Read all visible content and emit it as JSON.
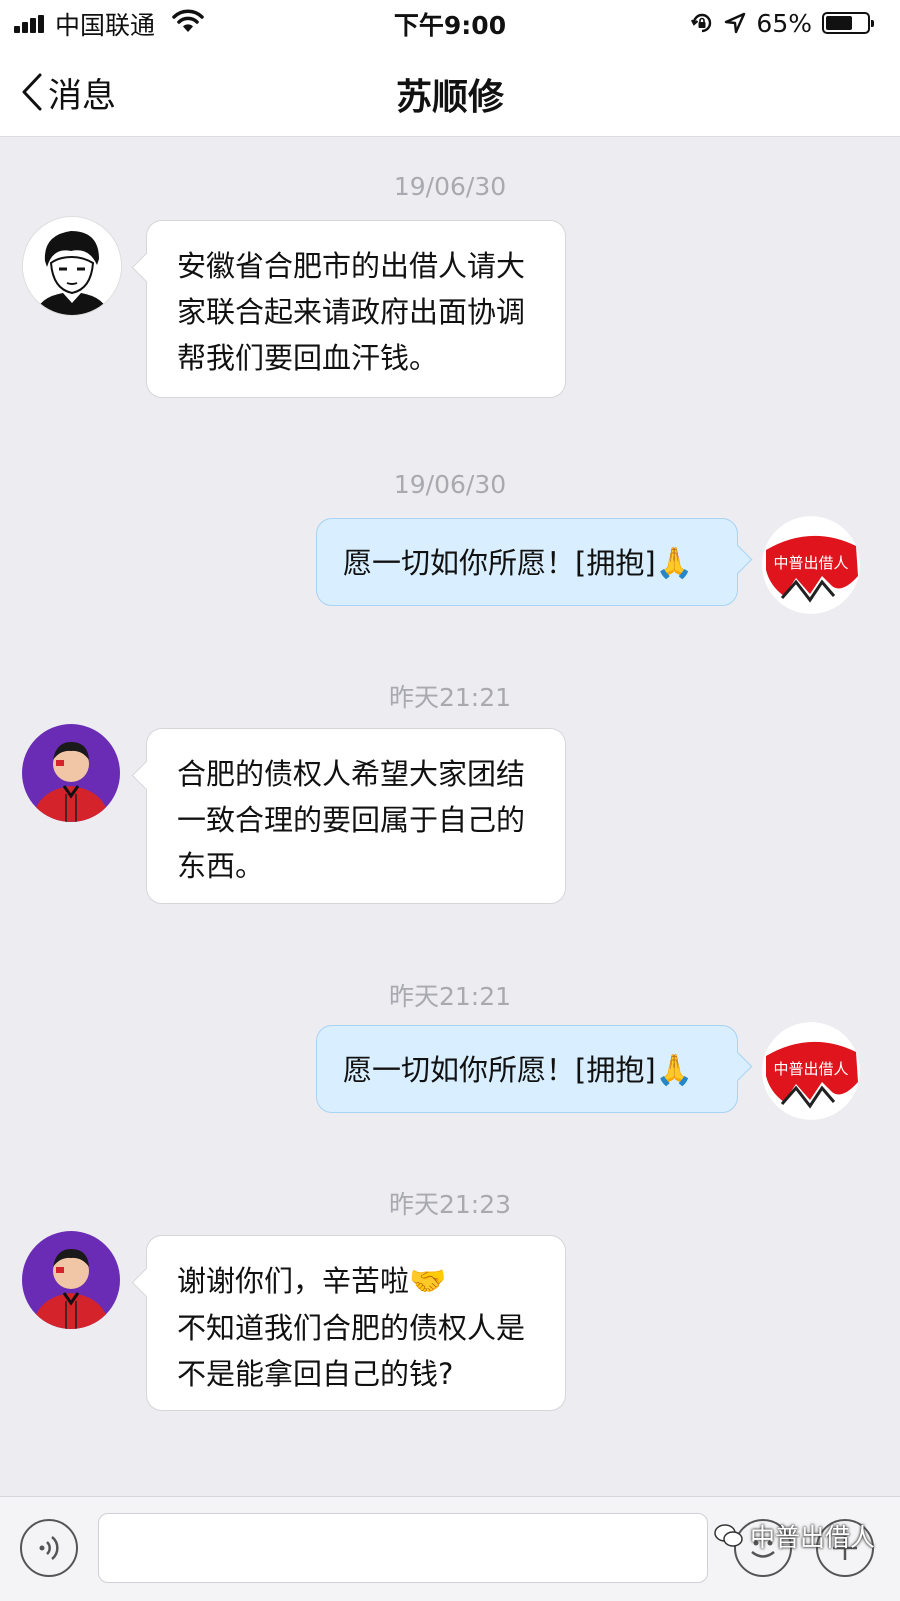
{
  "status_bar": {
    "carrier": "中国联通",
    "time": "下午9:00",
    "battery": "65%",
    "battery_level": 0.65
  },
  "nav": {
    "back_label": "消息",
    "title": "苏顺修"
  },
  "messages": [
    {
      "timestamp": "19/06/30",
      "direction": "incoming",
      "avatar": "black-white-portrait",
      "lines": [
        "安徽省合肥市的出借人请大",
        "家联合起来请政府出面协调",
        "帮我们要回血汗钱。"
      ]
    },
    {
      "timestamp": "19/06/30",
      "direction": "outgoing",
      "avatar": "zhongpu-logo",
      "logo_text": "中普出借人",
      "text": "愿一切如你所愿！[拥抱]",
      "emoji": "🙏"
    },
    {
      "timestamp": "昨天21:21",
      "direction": "incoming",
      "avatar": "man-red-shirt",
      "lines": [
        "合肥的债权人希望大家团结",
        "一致合理的要回属于自己的",
        "东西。"
      ]
    },
    {
      "timestamp": "昨天21:21",
      "direction": "outgoing",
      "avatar": "zhongpu-logo",
      "logo_text": "中普出借人",
      "text": "愿一切如你所愿！[拥抱]",
      "emoji": "🙏"
    },
    {
      "timestamp": "昨天21:23",
      "direction": "incoming",
      "avatar": "man-red-shirt",
      "lines": [
        "谢谢你们，辛苦啦",
        "不知道我们合肥的债权人是",
        "不是能拿回自己的钱?"
      ],
      "line1_emoji": "🤝"
    }
  ],
  "watermark": "中普出借人",
  "colors": {
    "background": "#ececf1",
    "incoming_bubble": "#ffffff",
    "outgoing_bubble": "#d9efff",
    "timestamp": "#a9a9b0",
    "logo_red": "#e0141c"
  },
  "icons": [
    "back-chevron-icon",
    "voice-icon",
    "emoji-icon",
    "plus-icon",
    "wifi-icon",
    "signal-icon",
    "location-icon",
    "rotation-lock-icon"
  ]
}
